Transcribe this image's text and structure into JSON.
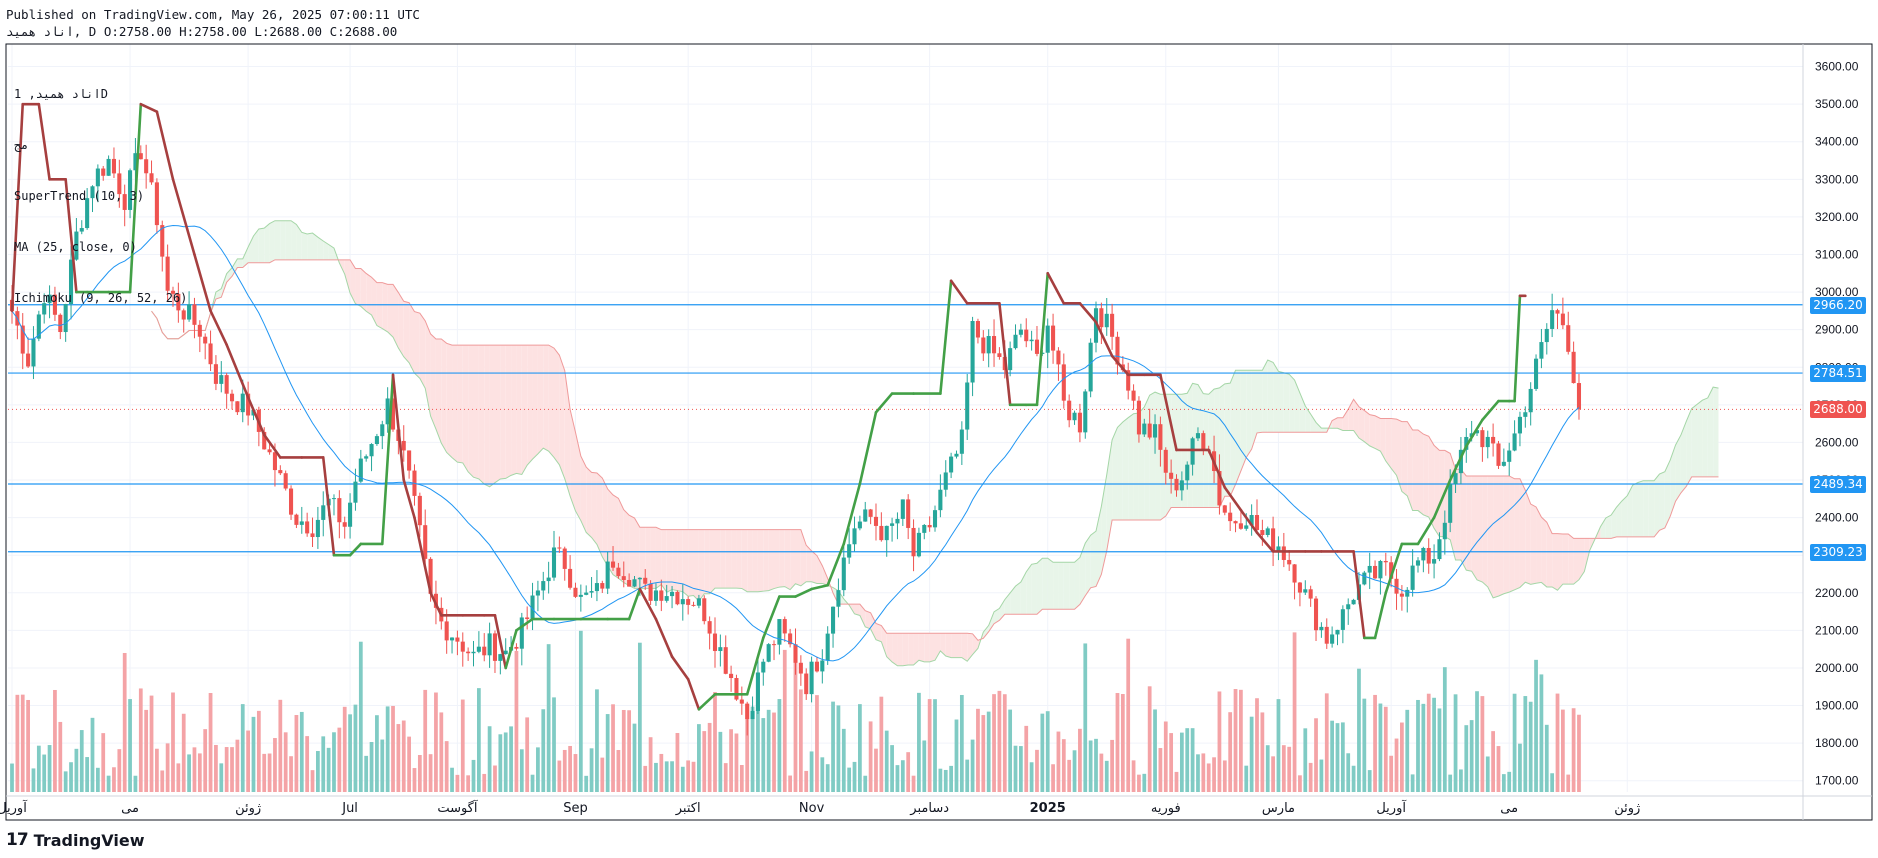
{
  "header": {
    "published": "Published on TradingView.com, May 26, 2025 07:00:11 UTC",
    "ohlc": "اناد همید, D O:2758.00 H:2758.00 L:2688.00 C:2688.00"
  },
  "legend": {
    "symbol": "اناد همید, 1D",
    "exchange": "مج",
    "supertrend": "SuperTrend (10, 3)",
    "ma": "MA (25, close, 0)",
    "ichimoku": "Ichimoku (9, 26, 52, 26)"
  },
  "footer": {
    "brand": "TradingView",
    "logo_glyph": "17"
  },
  "colors": {
    "up": "#26a69a",
    "down": "#ef5350",
    "vol_up": "#80cbc4",
    "vol_down": "#f4a3a6",
    "st_up": "#43a047",
    "st_down": "#a63f3f",
    "ma": "#2196f3",
    "hline": "#2196f3",
    "cloud_bull": "#e8f5e9",
    "cloud_bear": "#fde2e2",
    "last_price": "#ef5350"
  },
  "chart_data": {
    "type": "candlestick",
    "ylim": [
      1670,
      3660
    ],
    "y_ticks": [
      "1700.00",
      "1800.00",
      "1900.00",
      "2000.00",
      "2100.00",
      "2200.00",
      "2300.00",
      "2400.00",
      "2500.00",
      "2600.00",
      "2700.00",
      "2800.00",
      "2900.00",
      "3000.00",
      "3100.00",
      "3200.00",
      "3300.00",
      "3400.00",
      "3500.00",
      "3600.00"
    ],
    "x_labels": [
      {
        "label": "آوریل",
        "i": 0
      },
      {
        "label": "می",
        "i": 22
      },
      {
        "label": "ژوئن",
        "i": 44
      },
      {
        "label": "Jul",
        "i": 63
      },
      {
        "label": "آگوست",
        "i": 83
      },
      {
        "label": "Sep",
        "i": 105
      },
      {
        "label": "اکتبر",
        "i": 126
      },
      {
        "label": "Nov",
        "i": 149
      },
      {
        "label": "دسامبر",
        "i": 171
      },
      {
        "label": "2025",
        "i": 193
      },
      {
        "label": "فوریه",
        "i": 215
      },
      {
        "label": "مارس",
        "i": 236
      },
      {
        "label": "آوریل",
        "i": 257
      },
      {
        "label": "می",
        "i": 279
      },
      {
        "label": "ژوئن",
        "i": 301
      }
    ],
    "horizontal_levels": [
      {
        "value": 2966.2,
        "label": "2966.20"
      },
      {
        "value": 2784.51,
        "label": "2784.51"
      },
      {
        "value": 2489.34,
        "label": "2489.34"
      },
      {
        "value": 2309.23,
        "label": "2309.23"
      }
    ],
    "last_price": {
      "value": 2688.0,
      "label": "2688.00"
    },
    "close_keypoints": [
      [
        0,
        2950
      ],
      [
        3,
        2820
      ],
      [
        6,
        3000
      ],
      [
        9,
        2900
      ],
      [
        12,
        3150
      ],
      [
        15,
        3300
      ],
      [
        18,
        3350
      ],
      [
        21,
        3250
      ],
      [
        24,
        3380
      ],
      [
        27,
        3200
      ],
      [
        29,
        3000
      ],
      [
        32,
        2950
      ],
      [
        35,
        2900
      ],
      [
        38,
        2780
      ],
      [
        41,
        2720
      ],
      [
        44,
        2690
      ],
      [
        47,
        2600
      ],
      [
        50,
        2500
      ],
      [
        53,
        2400
      ],
      [
        56,
        2380
      ],
      [
        59,
        2440
      ],
      [
        62,
        2380
      ],
      [
        64,
        2500
      ],
      [
        67,
        2600
      ],
      [
        70,
        2700
      ],
      [
        72,
        2620
      ],
      [
        74,
        2500
      ],
      [
        76,
        2350
      ],
      [
        78,
        2180
      ],
      [
        80,
        2120
      ],
      [
        83,
        2080
      ],
      [
        86,
        2030
      ],
      [
        89,
        2060
      ],
      [
        92,
        2040
      ],
      [
        95,
        2100
      ],
      [
        98,
        2200
      ],
      [
        101,
        2300
      ],
      [
        103,
        2280
      ],
      [
        106,
        2180
      ],
      [
        109,
        2200
      ],
      [
        112,
        2290
      ],
      [
        115,
        2250
      ],
      [
        118,
        2200
      ],
      [
        121,
        2210
      ],
      [
        124,
        2200
      ],
      [
        127,
        2180
      ],
      [
        129,
        2150
      ],
      [
        131,
        2080
      ],
      [
        134,
        1980
      ],
      [
        137,
        1870
      ],
      [
        140,
        2020
      ],
      [
        143,
        2100
      ],
      [
        146,
        2030
      ],
      [
        148,
        1960
      ],
      [
        151,
        2050
      ],
      [
        154,
        2240
      ],
      [
        157,
        2380
      ],
      [
        160,
        2400
      ],
      [
        163,
        2350
      ],
      [
        166,
        2420
      ],
      [
        168,
        2300
      ],
      [
        171,
        2380
      ],
      [
        174,
        2500
      ],
      [
        177,
        2600
      ],
      [
        179,
        2900
      ],
      [
        182,
        2850
      ],
      [
        185,
        2800
      ],
      [
        188,
        2900
      ],
      [
        191,
        2820
      ],
      [
        193,
        2920
      ],
      [
        196,
        2700
      ],
      [
        199,
        2650
      ],
      [
        202,
        2970
      ],
      [
        205,
        2880
      ],
      [
        208,
        2760
      ],
      [
        210,
        2640
      ],
      [
        213,
        2620
      ],
      [
        216,
        2480
      ],
      [
        218,
        2510
      ],
      [
        221,
        2620
      ],
      [
        223,
        2600
      ],
      [
        225,
        2450
      ],
      [
        227,
        2390
      ],
      [
        230,
        2410
      ],
      [
        233,
        2350
      ],
      [
        236,
        2330
      ],
      [
        239,
        2260
      ],
      [
        242,
        2160
      ],
      [
        245,
        2080
      ],
      [
        248,
        2140
      ],
      [
        250,
        2200
      ],
      [
        253,
        2240
      ],
      [
        256,
        2260
      ],
      [
        259,
        2210
      ],
      [
        262,
        2280
      ],
      [
        265,
        2300
      ],
      [
        267,
        2410
      ],
      [
        270,
        2560
      ],
      [
        272,
        2640
      ],
      [
        275,
        2600
      ],
      [
        277,
        2530
      ],
      [
        280,
        2620
      ],
      [
        283,
        2750
      ],
      [
        285,
        2850
      ],
      [
        287,
        2950
      ],
      [
        289,
        2920
      ],
      [
        290,
        2870
      ],
      [
        291,
        2758
      ],
      [
        292,
        2688
      ]
    ],
    "volume_range": [
      0,
      100
    ],
    "supertrend_keypoints": [
      [
        0,
        2950,
        "d"
      ],
      [
        2,
        3500,
        "d"
      ],
      [
        5,
        3500,
        "d"
      ],
      [
        7,
        3300,
        "d"
      ],
      [
        10,
        3300,
        "d"
      ],
      [
        12,
        3000,
        "u"
      ],
      [
        14,
        3000,
        "u"
      ],
      [
        18,
        3000,
        "u"
      ],
      [
        20,
        3000,
        "u"
      ],
      [
        22,
        3000,
        "u"
      ],
      [
        24,
        3500,
        "d"
      ],
      [
        27,
        3480,
        "d"
      ],
      [
        30,
        3300,
        "d"
      ],
      [
        34,
        3100,
        "d"
      ],
      [
        37,
        2950,
        "d"
      ],
      [
        40,
        2860,
        "d"
      ],
      [
        44,
        2720,
        "d"
      ],
      [
        47,
        2620,
        "d"
      ],
      [
        50,
        2560,
        "d"
      ],
      [
        54,
        2560,
        "d"
      ],
      [
        58,
        2560,
        "d"
      ],
      [
        60,
        2300,
        "u"
      ],
      [
        63,
        2300,
        "u"
      ],
      [
        65,
        2330,
        "u"
      ],
      [
        69,
        2330,
        "u"
      ],
      [
        71,
        2780,
        "d"
      ],
      [
        73,
        2500,
        "d"
      ],
      [
        75,
        2400,
        "d"
      ],
      [
        78,
        2200,
        "d"
      ],
      [
        80,
        2140,
        "d"
      ],
      [
        84,
        2140,
        "d"
      ],
      [
        88,
        2140,
        "d"
      ],
      [
        90,
        2140,
        "d"
      ],
      [
        92,
        2000,
        "u"
      ],
      [
        94,
        2100,
        "u"
      ],
      [
        97,
        2130,
        "u"
      ],
      [
        101,
        2130,
        "u"
      ],
      [
        106,
        2130,
        "u"
      ],
      [
        111,
        2130,
        "u"
      ],
      [
        115,
        2130,
        "u"
      ],
      [
        117,
        2210,
        "d"
      ],
      [
        120,
        2130,
        "d"
      ],
      [
        123,
        2030,
        "d"
      ],
      [
        126,
        1970,
        "d"
      ],
      [
        128,
        1890,
        "u"
      ],
      [
        131,
        1930,
        "u"
      ],
      [
        134,
        1930,
        "u"
      ],
      [
        137,
        1930,
        "u"
      ],
      [
        140,
        2080,
        "u"
      ],
      [
        143,
        2190,
        "u"
      ],
      [
        146,
        2190,
        "u"
      ],
      [
        149,
        2210,
        "u"
      ],
      [
        152,
        2220,
        "u"
      ],
      [
        155,
        2330,
        "u"
      ],
      [
        158,
        2490,
        "u"
      ],
      [
        161,
        2680,
        "u"
      ],
      [
        164,
        2730,
        "u"
      ],
      [
        168,
        2730,
        "u"
      ],
      [
        173,
        2730,
        "u"
      ],
      [
        175,
        3030,
        "d"
      ],
      [
        178,
        2970,
        "d"
      ],
      [
        182,
        2970,
        "d"
      ],
      [
        184,
        2970,
        "d"
      ],
      [
        186,
        2700,
        "u"
      ],
      [
        189,
        2700,
        "u"
      ],
      [
        191,
        2700,
        "u"
      ],
      [
        193,
        3050,
        "d"
      ],
      [
        196,
        2970,
        "d"
      ],
      [
        199,
        2970,
        "d"
      ],
      [
        202,
        2920,
        "d"
      ],
      [
        205,
        2830,
        "d"
      ],
      [
        208,
        2780,
        "d"
      ],
      [
        211,
        2780,
        "d"
      ],
      [
        214,
        2780,
        "d"
      ],
      [
        217,
        2580,
        "d"
      ],
      [
        220,
        2580,
        "d"
      ],
      [
        223,
        2580,
        "d"
      ],
      [
        226,
        2480,
        "d"
      ],
      [
        229,
        2420,
        "d"
      ],
      [
        232,
        2360,
        "d"
      ],
      [
        235,
        2310,
        "d"
      ],
      [
        238,
        2310,
        "d"
      ],
      [
        241,
        2310,
        "d"
      ],
      [
        244,
        2310,
        "d"
      ],
      [
        247,
        2310,
        "d"
      ],
      [
        250,
        2310,
        "d"
      ],
      [
        252,
        2080,
        "u"
      ],
      [
        254,
        2080,
        "u"
      ],
      [
        256,
        2200,
        "u"
      ],
      [
        259,
        2330,
        "u"
      ],
      [
        262,
        2330,
        "u"
      ],
      [
        265,
        2400,
        "u"
      ],
      [
        268,
        2500,
        "u"
      ],
      [
        271,
        2590,
        "u"
      ],
      [
        274,
        2660,
        "u"
      ],
      [
        277,
        2710,
        "u"
      ],
      [
        279,
        2710,
        "u"
      ],
      [
        280,
        2710,
        "u"
      ],
      [
        281,
        2990,
        "d"
      ],
      [
        282,
        2990,
        "d"
      ]
    ]
  }
}
